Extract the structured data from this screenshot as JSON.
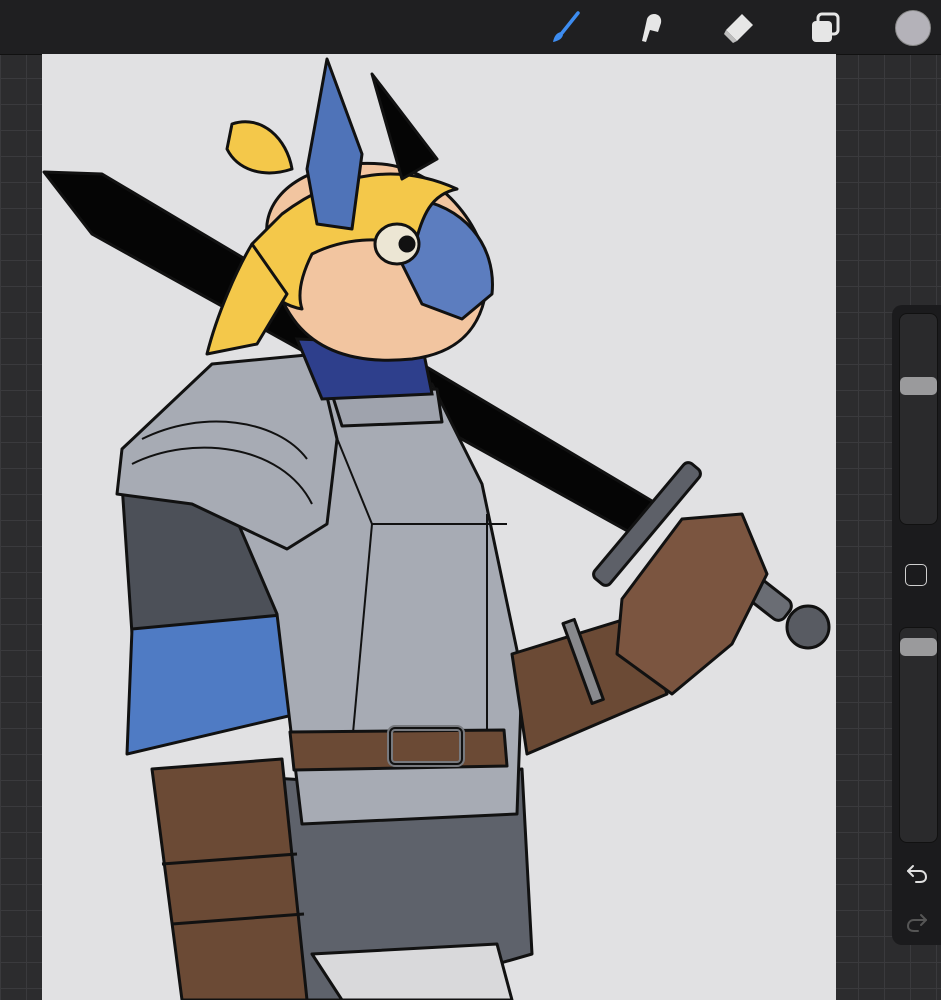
{
  "toolbar": {
    "tools": [
      {
        "name": "brush",
        "icon": "brush-icon",
        "active": true
      },
      {
        "name": "smudge",
        "icon": "smudge-icon",
        "active": false
      },
      {
        "name": "eraser",
        "icon": "eraser-icon",
        "active": false
      },
      {
        "name": "layers",
        "icon": "layers-icon",
        "active": false
      }
    ],
    "color": "#b4b2b9",
    "active_color": "#3d8cf0",
    "inactive_color": "#e6e6e6"
  },
  "sidebar": {
    "brush_size_level": 0.67,
    "brush_opacity_level": 0.95,
    "undo_icon": "undo-icon",
    "redo_icon": "redo-icon",
    "redo_enabled": false
  },
  "canvas": {
    "background": "#e1e1e3",
    "artwork": "knight-character-illustration"
  }
}
